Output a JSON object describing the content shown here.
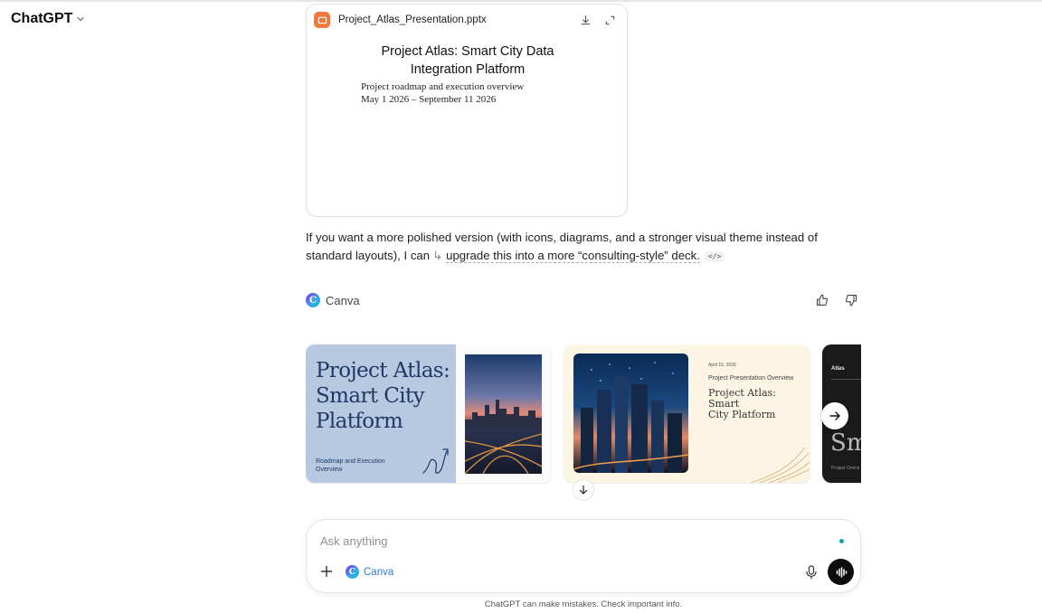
{
  "header": {
    "model_name": "ChatGPT"
  },
  "file_card": {
    "file_name": "Project_Atlas_Presentation.pptx",
    "slide_title_line1": "Project Atlas: Smart City Data",
    "slide_title_line2": "Integration Platform",
    "slide_subtitle_line1": "Project roadmap and execution overview",
    "slide_subtitle_line2": "May 1 2026 – September 11 2026"
  },
  "reply": {
    "text_before": "If you want a more polished version (with icons, diagrams, and a stronger visual theme instead of standard layouts), I can",
    "arrow": "↳",
    "link_text": "upgrade this into a more “consulting-style” deck.",
    "code_chip": "</>"
  },
  "canva_header": {
    "logo_letter": "C",
    "label": "Canva"
  },
  "designs": [
    {
      "title_line1": "Project Atlas:",
      "title_line2": "Smart City",
      "title_line3": "Platform",
      "subtitle_line1": "Roadmap and Execution",
      "subtitle_line2": "Overview"
    },
    {
      "date": "April 15, 2026",
      "overview": "Project Presentation Overview",
      "title_line1": "Project Atlas: Smart",
      "title_line2": "City Platform"
    },
    {
      "label": "Atlas",
      "big_text": "Sma",
      "subtitle": "Project Overvi"
    }
  ],
  "composer": {
    "placeholder": "Ask anything",
    "tool_label": "Canva"
  },
  "footer": {
    "disclaimer": "ChatGPT can make mistakes. Check important info."
  },
  "colors": {
    "file_icon": "#ef7a3c",
    "design1_blue": "#b6c9e0",
    "design1_title": "#1f3864",
    "design2_cream": "#fdf5e4",
    "canva_tool": "#2b7ad9",
    "status_dot": "#10a3a3"
  }
}
